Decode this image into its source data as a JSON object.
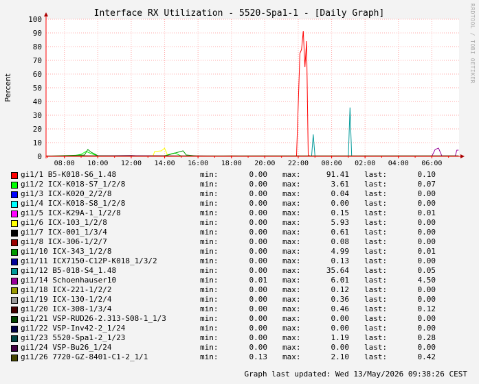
{
  "chart_data": {
    "type": "line",
    "title": "Interface RX Utilization - 5520-Spa1-1 - [Daily Graph]",
    "ylabel": "Percent",
    "xlabel": "",
    "ylim": [
      0,
      100
    ],
    "yticks": [
      0,
      10,
      20,
      30,
      40,
      50,
      60,
      70,
      80,
      90,
      100
    ],
    "x_range": [
      6.9,
      9.63
    ],
    "xtick_hours": [
      8,
      10,
      12,
      14,
      16,
      18,
      20,
      22,
      24,
      26,
      28,
      30
    ],
    "xtick_labels": [
      "08:00",
      "10:00",
      "12:00",
      "14:00",
      "16:00",
      "18:00",
      "20:00",
      "22:00",
      "00:00",
      "02:00",
      "04:00",
      "06:00",
      "08:00"
    ],
    "grid": true,
    "legend_position": "bottom",
    "series": [
      {
        "name": "gi1/1 B5-K018-S6_1.48",
        "color": "#ff0000",
        "min": "0.00",
        "max": "91.41",
        "last": "0.10",
        "points": [
          [
            6.9,
            0.1
          ],
          [
            8,
            0.2
          ],
          [
            9.5,
            0.3
          ],
          [
            10.5,
            0.2
          ],
          [
            11,
            0.5
          ],
          [
            11.5,
            0.3
          ],
          [
            12,
            0.2
          ],
          [
            13.5,
            0.4
          ],
          [
            15,
            0.2
          ],
          [
            16,
            0.3
          ],
          [
            17,
            0.2
          ],
          [
            18,
            0.3
          ],
          [
            19,
            0.2
          ],
          [
            20,
            0.2
          ],
          [
            21,
            0.2
          ],
          [
            21.9,
            0.3
          ],
          [
            22.1,
            75
          ],
          [
            22.2,
            78
          ],
          [
            22.3,
            91.4
          ],
          [
            22.4,
            65
          ],
          [
            22.5,
            84
          ],
          [
            22.6,
            1
          ],
          [
            22.7,
            0.2
          ],
          [
            23,
            0.1
          ],
          [
            24,
            0.1
          ],
          [
            26,
            0.2
          ],
          [
            27.5,
            0.1
          ],
          [
            29,
            0.1
          ],
          [
            30,
            0.1
          ],
          [
            31.6,
            0.1
          ]
        ]
      },
      {
        "name": "gi1/2 ICX-K018-S7_1/2/8",
        "color": "#00ff00",
        "min": "0.00",
        "max": "3.61",
        "last": "0.07",
        "points": [
          [
            6.9,
            0.1
          ],
          [
            8.5,
            0.3
          ],
          [
            9,
            1.5
          ],
          [
            9.3,
            3.6
          ],
          [
            9.6,
            2
          ],
          [
            10,
            0.5
          ],
          [
            11,
            0.2
          ],
          [
            12,
            0.3
          ],
          [
            13,
            0.2
          ],
          [
            14,
            0.5
          ],
          [
            14.6,
            2.5
          ],
          [
            15,
            0.3
          ],
          [
            16,
            0.2
          ],
          [
            20,
            0.1
          ],
          [
            24,
            0.1
          ],
          [
            31.6,
            0.07
          ]
        ]
      },
      {
        "name": "gi1/3 ICX-K020_2/2/8",
        "color": "#0000ff",
        "min": "0.00",
        "max": "0.04",
        "last": "0.00",
        "points": [
          [
            6.9,
            0
          ],
          [
            31.6,
            0
          ]
        ]
      },
      {
        "name": "gi1/4 ICX-K018-S8_1/2/8",
        "color": "#00ffff",
        "min": "0.00",
        "max": "0.00",
        "last": "0.00",
        "points": [
          [
            6.9,
            0
          ],
          [
            31.6,
            0
          ]
        ]
      },
      {
        "name": "gi1/5 ICX-K29A-1_1/2/8",
        "color": "#ff00ff",
        "min": "0.00",
        "max": "0.15",
        "last": "0.01",
        "points": [
          [
            6.9,
            0
          ],
          [
            31.6,
            0
          ]
        ]
      },
      {
        "name": "gi1/6 ICX-103_1/2/8",
        "color": "#ffff00",
        "min": "0.00",
        "max": "5.93",
        "last": "0.00",
        "points": [
          [
            6.9,
            0
          ],
          [
            13.3,
            0
          ],
          [
            13.4,
            3.5
          ],
          [
            13.8,
            4
          ],
          [
            14,
            5.9
          ],
          [
            14.2,
            0.2
          ],
          [
            15,
            0
          ],
          [
            31.6,
            0
          ]
        ]
      },
      {
        "name": "gi1/7 ICX-001_1/3/4",
        "color": "#000000",
        "min": "0.00",
        "max": "0.61",
        "last": "0.00",
        "points": [
          [
            6.9,
            0.1
          ],
          [
            12,
            0.6
          ],
          [
            13,
            0.2
          ],
          [
            16,
            0.1
          ],
          [
            31.6,
            0
          ]
        ]
      },
      {
        "name": "gi1/8 ICX-306-1/2/7",
        "color": "#990000",
        "min": "0.00",
        "max": "0.08",
        "last": "0.00",
        "points": [
          [
            6.9,
            0
          ],
          [
            31.6,
            0
          ]
        ]
      },
      {
        "name": "gi1/10 ICX-343_1/2/8",
        "color": "#009900",
        "min": "0.00",
        "max": "4.99",
        "last": "0.01",
        "points": [
          [
            6.9,
            0.1
          ],
          [
            9.2,
            1
          ],
          [
            9.4,
            5
          ],
          [
            9.6,
            3
          ],
          [
            10,
            0.5
          ],
          [
            14,
            0.3
          ],
          [
            15.1,
            4
          ],
          [
            15.3,
            1
          ],
          [
            16,
            0.2
          ],
          [
            31.6,
            0
          ]
        ]
      },
      {
        "name": "gi1/11 ICX7150-C12P-K018_1/3/2",
        "color": "#000099",
        "min": "0.00",
        "max": "0.13",
        "last": "0.00",
        "points": [
          [
            6.9,
            0
          ],
          [
            31.6,
            0
          ]
        ]
      },
      {
        "name": "gi1/12 B5-018-S4_1.48",
        "color": "#009999",
        "min": "0.00",
        "max": "35.64",
        "last": "0.05",
        "points": [
          [
            6.9,
            0
          ],
          [
            22.8,
            0
          ],
          [
            22.9,
            16
          ],
          [
            23,
            0.3
          ],
          [
            23.2,
            0
          ],
          [
            25,
            0
          ],
          [
            25.1,
            35.6
          ],
          [
            25.2,
            0.3
          ],
          [
            26,
            0.1
          ],
          [
            31.6,
            0.05
          ]
        ]
      },
      {
        "name": "gi1/14 Schoenhauser10",
        "color": "#990099",
        "min": "0.01",
        "max": "6.01",
        "last": "4.50",
        "points": [
          [
            6.9,
            0.1
          ],
          [
            12,
            0.5
          ],
          [
            20,
            0.1
          ],
          [
            28,
            0.1
          ],
          [
            30,
            0.1
          ],
          [
            30.2,
            5
          ],
          [
            30.4,
            6
          ],
          [
            30.6,
            0.3
          ],
          [
            31.4,
            0.3
          ],
          [
            31.5,
            4.5
          ],
          [
            31.6,
            4.5
          ]
        ]
      },
      {
        "name": "gi1/18 ICX-221-1/2/2",
        "color": "#999900",
        "min": "0.00",
        "max": "0.12",
        "last": "0.00",
        "points": [
          [
            6.9,
            0
          ],
          [
            31.6,
            0
          ]
        ]
      },
      {
        "name": "gi1/19 ICX-130-1/2/4",
        "color": "#999999",
        "min": "0.00",
        "max": "0.36",
        "last": "0.00",
        "points": [
          [
            6.9,
            0
          ],
          [
            31.6,
            0
          ]
        ]
      },
      {
        "name": "gi1/20 ICX-308-1/3/4",
        "color": "#440000",
        "min": "0.00",
        "max": "0.46",
        "last": "0.12",
        "points": [
          [
            6.9,
            0.1
          ],
          [
            31.6,
            0.12
          ]
        ]
      },
      {
        "name": "gi1/21 VSP-RUD26-2.313-S08-1_1/3",
        "color": "#004400",
        "min": "0.00",
        "max": "0.00",
        "last": "0.00",
        "points": [
          [
            6.9,
            0
          ],
          [
            31.6,
            0
          ]
        ]
      },
      {
        "name": "gi1/22 VSP-Inv42-2_1/24",
        "color": "#000044",
        "min": "0.00",
        "max": "0.00",
        "last": "0.00",
        "points": [
          [
            6.9,
            0
          ],
          [
            31.6,
            0
          ]
        ]
      },
      {
        "name": "gi1/23 5520-Spa1-2_1/23",
        "color": "#004444",
        "min": "0.00",
        "max": "1.19",
        "last": "0.28",
        "points": [
          [
            6.9,
            0.2
          ],
          [
            31.6,
            0.28
          ]
        ]
      },
      {
        "name": "gi1/24 VSP-Bu26_1/24",
        "color": "#440044",
        "min": "0.00",
        "max": "0.00",
        "last": "0.00",
        "points": [
          [
            6.9,
            0
          ],
          [
            31.6,
            0
          ]
        ]
      },
      {
        "name": "gi1/26 7720-GZ-8401-C1-2_1/1",
        "color": "#444400",
        "min": "0.13",
        "max": "2.10",
        "last": "0.42",
        "points": [
          [
            6.9,
            0.3
          ],
          [
            31.6,
            0.42
          ]
        ]
      }
    ]
  },
  "legend_labels": {
    "min": "min:",
    "max": "max:",
    "last": "last:"
  },
  "footer": {
    "updated": "Graph last updated: Wed 13/May/2026 09:38:26 CEST"
  },
  "watermark": "RRDTOOL / TOBI OETIKER"
}
